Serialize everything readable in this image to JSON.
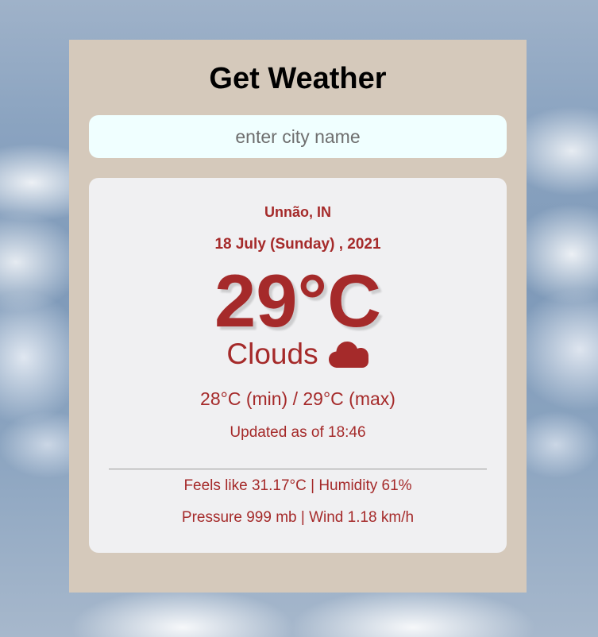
{
  "header": {
    "title": "Get Weather"
  },
  "search": {
    "placeholder": "enter city name",
    "value": ""
  },
  "weather": {
    "location": "Unnão, IN",
    "date": "18 July (Sunday) , 2021",
    "temperature": "29°C",
    "condition": "Clouds",
    "condition_icon": "cloud-icon",
    "min_max": "28°C (min) / 29°C (max)",
    "updated": "Updated as of 18:46",
    "details_line1": "Feels like 31.17°C | Humidity 61%",
    "details_line2": "Pressure 999 mb | Wind 1.18 km/h"
  },
  "colors": {
    "accent": "#a52a2a",
    "panel": "#d5c9bb",
    "card": "#f0f0f2",
    "input": "#f0ffff"
  }
}
